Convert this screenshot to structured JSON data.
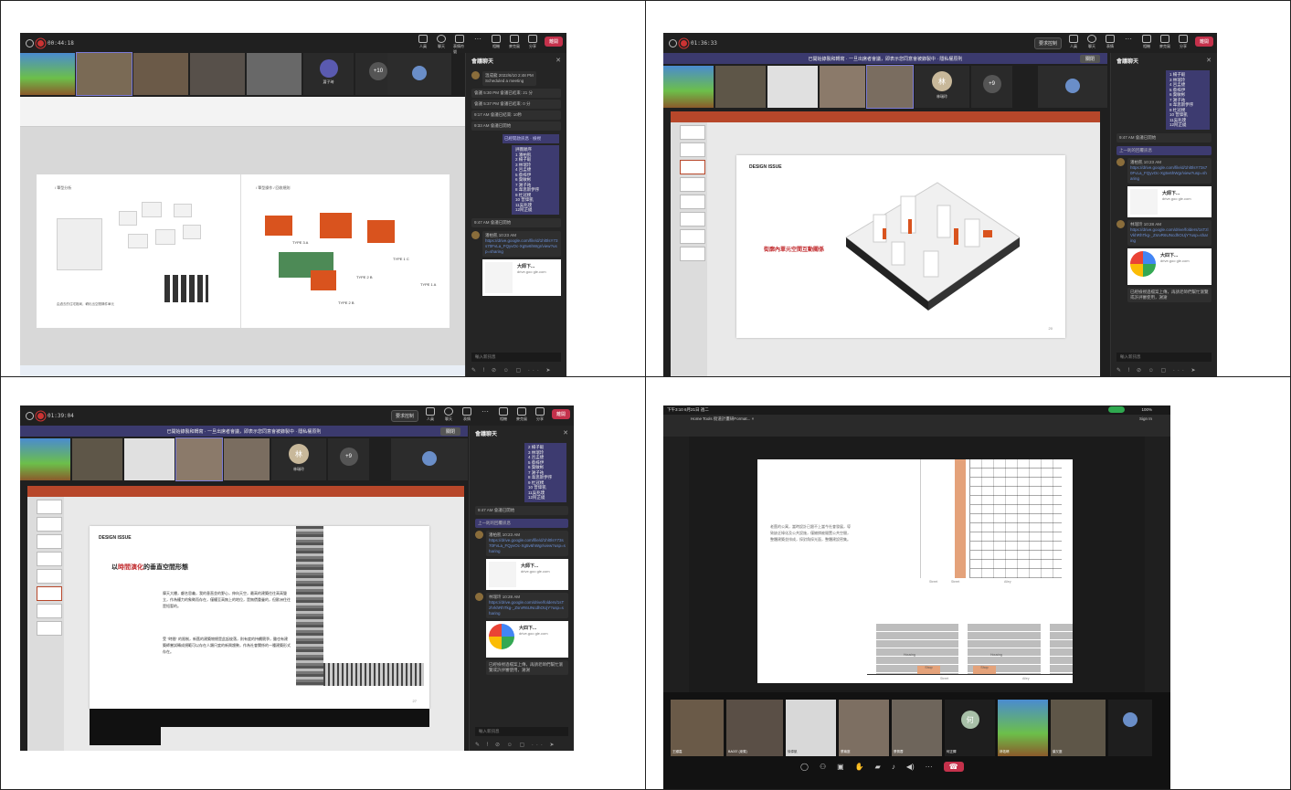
{
  "panel1": {
    "timer": "00:44:18",
    "participant_label": "蕭子琦",
    "overflow_count": "+10",
    "chat_title": "會議聊天",
    "chat_msgs": [
      {
        "name": "溫成龍",
        "time": "2022/6/10 2:48 PM",
        "text": "Scheduled a meeting"
      },
      {
        "name": "",
        "time": "",
        "text": "會議 5:30 PM  會議已結束: 21 分"
      },
      {
        "name": "",
        "time": "",
        "text": "會議 5:37 PM  會議已結束: 0 分"
      },
      {
        "name": "",
        "time": "",
        "text": "9:17 AM  會議已結束: 10秒"
      },
      {
        "name": "",
        "time": "",
        "text": "9:33 AM  會議已開始"
      }
    ],
    "list_link": "已經開啟訊息 · 檢視",
    "list_items": [
      "評圖順序",
      "1 潘柏凱",
      "2 楊子毅",
      "3 林瑞玲",
      "4 呂孟捷",
      "5 蔡梓伊",
      "6 葉敏彬",
      "7 謝子祐",
      "8 韋思斯伊序",
      "9 杜冠樸",
      "10 曾偉凱",
      "11吳兆璞",
      "12阿芷緹"
    ],
    "evt_started": "9:47 AM  會議已開始",
    "link_msg": {
      "name": "潘柏凱",
      "time": "10:23 AM",
      "url": "https://drive.google.com/file/d/1hl0lsY73s70FvLa_FQyvOc-Xg5v6hWgr/view?usp=sharing"
    },
    "card_title": "大師下...",
    "card_sub": "drive.goo gle.com",
    "input_placeholder": "輸入新訊息",
    "slide_caption_left": "/ 單型分析",
    "slide_caption_right": "/ 單型操作 / 回收規則",
    "type_labels": [
      "TYPE 3 A",
      "TYPE 2 B",
      "TYPE 1 C",
      "TYPE 1 A",
      "TYPE 2 B"
    ],
    "slide_note": "由過去的住宅格局，轉化出空間構件單元"
  },
  "panel2": {
    "timer": "01:36:33",
    "request_btn": "要求控制",
    "banner_text": "已開始錄製和轉寫 · 一旦出席者會議，即表示您同意會被錄製中 · 隱私權原則",
    "dismiss": "關閉",
    "leave": "離開",
    "avatar_initial": "林",
    "avatar_name": "林瑞玲",
    "overflow_count": "+9",
    "slide_heading": "DESIGN ISSUE",
    "slide_red_text": "街廓內單元空間互動關係",
    "page_no": "20",
    "chat_title": "會議聊天",
    "list_items": [
      "1 楊子毅",
      "3 林瑞玲",
      "4 呂孟捷",
      "5 蔡梓伊",
      "6 葉敏彬",
      "7 謝子祐",
      "8 韋思斯伊序",
      "9 杜冠樸",
      "10 曾偉凱",
      "11吳兆璞",
      "12阿芷緹"
    ],
    "evt_started": "9:47 AM  會議已開始",
    "evt_sub": "上一則的回覆訊息",
    "msg1": {
      "name": "潘柏凱",
      "time": "10:23 AM",
      "url": "https://drive.google.com/file/d/1hl0lsY73s70FvLa_FQyvOc-Xg5v6hWgr/view?usp=sharing"
    },
    "card1_title": "大師下...",
    "card1_sub": "drive.goo gle.com",
    "msg2": {
      "name": "林瑞玲",
      "time": "10:28 AM",
      "url": "https://drive.google.com/drive/folders/1sTzlVkhRhTkg-_ZsrvR6UNcdhOUjY?usp=sharing"
    },
    "card2_title": "大四下...",
    "card2_sub": "drive.goo gle.com",
    "notice": "已經檢視過檔案上傳，再請老師們幫忙瀏覽或許評審使用，謝謝",
    "input_placeholder": "輸入新訊息"
  },
  "panel3": {
    "timer": "01:39:04",
    "request_btn": "要求控制",
    "banner_text": "已開始錄製和轉寫 · 一旦出席者會議，即表示您同意會被錄製中 · 隱私權原則",
    "dismiss": "關閉",
    "leave": "離開",
    "avatar_initial": "林",
    "avatar_name": "林瑞玲",
    "overflow_count": "+9",
    "slide_heading": "DESIGN ISSUE",
    "slide_title_pre": "以",
    "slide_title_red": "時間演化",
    "slide_title_post": "的垂直空間形態",
    "para1": "摩天大樓，顧名思義，我的垂直並的野心，伸向天空，最高的建築往往高高聳立，作為權力的象徵而存在，僅權至高無上的地位，是無價重疊的，但歐洲住往是短暫的。",
    "para2": "受 \"時間\" 的限制，新舊的建築物總是此起彼落，則有度的持續競爭，雖也有建築師嘗試轉成規範可以存在人類尺度的新興趨勢，作為社會關係的一種建築形式存在。",
    "page_no": "27",
    "chat_title": "會議聊天",
    "list_items": [
      "2 楊子毅",
      "3 林瑞玲",
      "4 呂孟捷",
      "5 蔡梓伊",
      "6 葉敏彬",
      "7 謝子祐",
      "8 韋思斯伊序",
      "9 杜冠樸",
      "10 曾偉凱",
      "11吳兆璞",
      "12阿芷緹"
    ],
    "evt_started": "9:47 AM  會議已開始",
    "evt_sub": "上一則的回覆訊息",
    "msg1": {
      "name": "潘柏凱",
      "time": "10:23 AM",
      "url": "https://drive.google.com/file/d/1hl0lsY73s70FvLa_FQyvOc-Xg5v6hWgr/view?usp=sharing"
    },
    "card1_title": "大師下...",
    "card1_sub": "drive.goo gle.com",
    "msg2": {
      "name": "林瑞玲",
      "time": "10:28 AM",
      "url": "https://drive.google.com/drive/folders/1sTzlVkhRhTkg-_ZsrvR6UNcdhOUjY?usp=sharing"
    },
    "card2_title": "大四下...",
    "card2_sub": "drive.goo gle.com",
    "notice": "已經檢視過檔案上傳，再請老師們幫忙瀏覽或許評審使用，謝謝",
    "input_placeholder": "輸入新訊息"
  },
  "panel4": {
    "status_time": "下午3:10  6月21日 週二",
    "battery": "100%",
    "tab_label": "Home  Tools  街道計畫研Format... ×",
    "sign_in": "Sign In",
    "slide_text": "老舊的公寓，當時設計已跟不上當今社會發展，導致缺乏綠化及公共設施，僅擁擠被閒置公共空間，整體建築並排成，採對角採光面，整體建設密集。",
    "street_labels": [
      "Street",
      "Street",
      "Alley",
      "Street",
      "Alley"
    ],
    "floor_labels": [
      "Housing",
      "Housing",
      "Shop",
      "Shop"
    ],
    "participants": [
      "王顯嘉",
      "BA037 (來賓)",
      "徐偉凱",
      "蔡瑜庭",
      "蔡佩蓉",
      "何正輝",
      "林佑晴",
      "葉又庭"
    ],
    "avatar_initial": "何",
    "avatar_name": "何正輝"
  },
  "colors": {
    "teams_bg": "#1f1f1f",
    "leave_red": "#c4314b",
    "banner": "#3b3a6e",
    "ppt_red": "#b7472a",
    "accent_red": "#c0282b",
    "orange": "#d9531e",
    "wood": "#e4a27a"
  }
}
